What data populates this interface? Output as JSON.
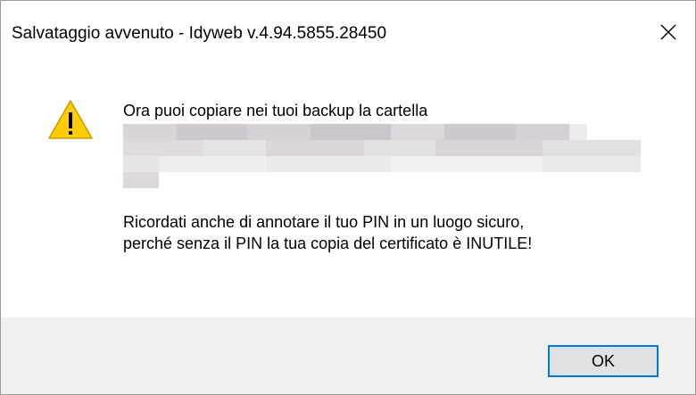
{
  "window": {
    "title": "Salvataggio avvenuto - Idyweb v.4.94.5855.28450",
    "close_icon": "close-icon"
  },
  "message": {
    "icon": "warning-icon",
    "icon_color": "#ffcc00",
    "line1": "Ora puoi copiare nei tuoi backup la cartella",
    "line2": "Ricordati anche di annotare il tuo PIN in un luogo sicuro,",
    "line3": "perché senza il PIN la tua copia del certificato è INUTILE!"
  },
  "buttons": {
    "ok_label": "OK",
    "ok_border_color": "#0078d7"
  }
}
